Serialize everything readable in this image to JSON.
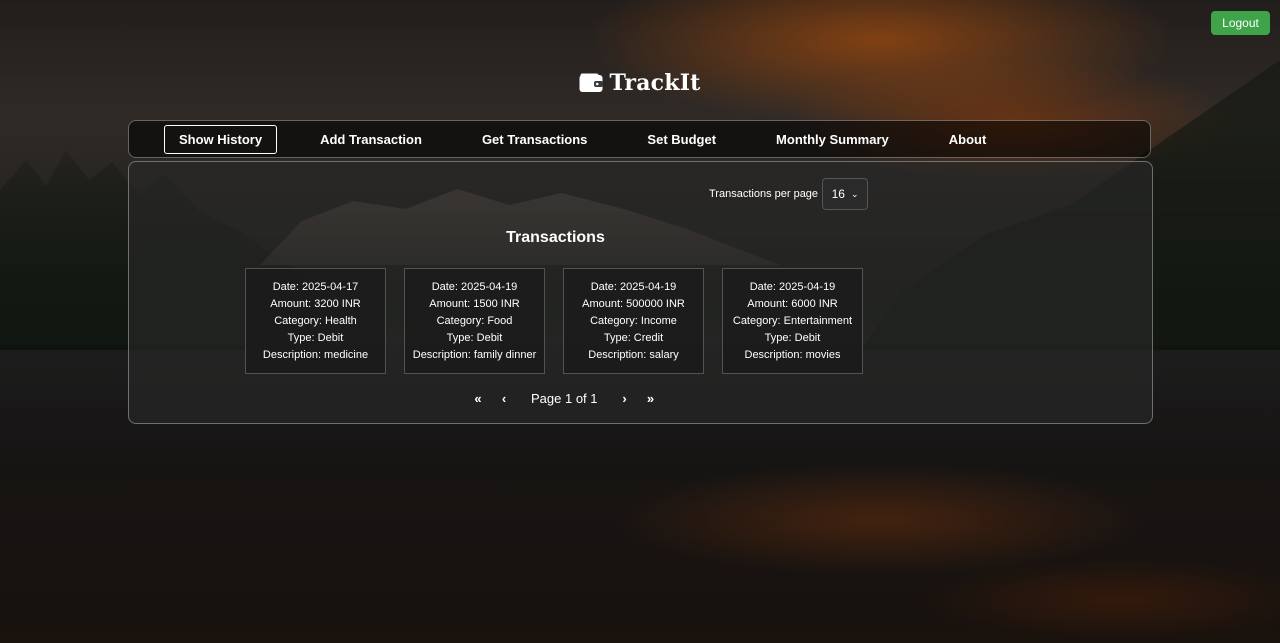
{
  "header": {
    "logout_label": "Logout",
    "brand_icon": "wallet-icon",
    "brand_title": "TrackIt"
  },
  "nav": {
    "items": [
      {
        "label": "Show History",
        "active": true
      },
      {
        "label": "Add Transaction",
        "active": false
      },
      {
        "label": "Get Transactions",
        "active": false
      },
      {
        "label": "Set Budget",
        "active": false
      },
      {
        "label": "Monthly Summary",
        "active": false
      },
      {
        "label": "About",
        "active": false
      }
    ]
  },
  "history": {
    "per_page_label": "Transactions per page",
    "per_page_value": "16",
    "title": "Transactions",
    "transactions": [
      {
        "date": "Date: 2025-04-17",
        "amount": "Amount: 3200 INR",
        "category": "Category: Health",
        "type": "Type: Debit",
        "description": "Description: medicine"
      },
      {
        "date": "Date: 2025-04-19",
        "amount": "Amount: 1500 INR",
        "category": "Category: Food",
        "type": "Type: Debit",
        "description": "Description: family dinner"
      },
      {
        "date": "Date: 2025-04-19",
        "amount": "Amount: 500000 INR",
        "category": "Category: Income",
        "type": "Type: Credit",
        "description": "Description: salary"
      },
      {
        "date": "Date: 2025-04-19",
        "amount": "Amount: 6000 INR",
        "category": "Category: Entertainment",
        "type": "Type: Debit",
        "description": "Description: movies"
      }
    ],
    "pagination": {
      "first": "«",
      "prev": "‹",
      "label": "Page 1 of 1",
      "next": "›",
      "last": "»"
    }
  },
  "colors": {
    "logout_green": "#3fa34a",
    "panel_bg": "rgba(40,40,40,0.62)"
  }
}
